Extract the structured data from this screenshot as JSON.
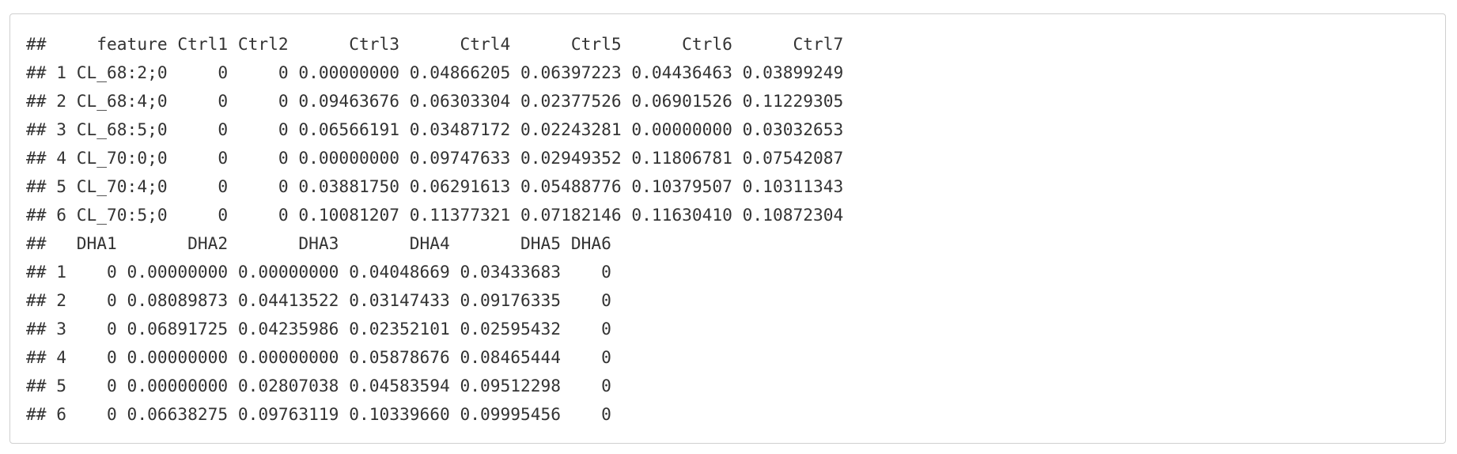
{
  "output": {
    "lines": [
      "##     feature Ctrl1 Ctrl2      Ctrl3      Ctrl4      Ctrl5      Ctrl6      Ctrl7",
      "## 1 CL_68:2;0     0     0 0.00000000 0.04866205 0.06397223 0.04436463 0.03899249",
      "## 2 CL_68:4;0     0     0 0.09463676 0.06303304 0.02377526 0.06901526 0.11229305",
      "## 3 CL_68:5;0     0     0 0.06566191 0.03487172 0.02243281 0.00000000 0.03032653",
      "## 4 CL_70:0;0     0     0 0.00000000 0.09747633 0.02949352 0.11806781 0.07542087",
      "## 5 CL_70:4;0     0     0 0.03881750 0.06291613 0.05488776 0.10379507 0.10311343",
      "## 6 CL_70:5;0     0     0 0.10081207 0.11377321 0.07182146 0.11630410 0.10872304",
      "##   DHA1       DHA2       DHA3       DHA4       DHA5 DHA6",
      "## 1    0 0.00000000 0.00000000 0.04048669 0.03433683    0",
      "## 2    0 0.08089873 0.04413522 0.03147433 0.09176335    0",
      "## 3    0 0.06891725 0.04235986 0.02352101 0.02595432    0",
      "## 4    0 0.00000000 0.00000000 0.05878676 0.08465444    0",
      "## 5    0 0.00000000 0.02807038 0.04583594 0.09512298    0",
      "## 6    0 0.06638275 0.09763119 0.10339660 0.09995456    0"
    ]
  }
}
